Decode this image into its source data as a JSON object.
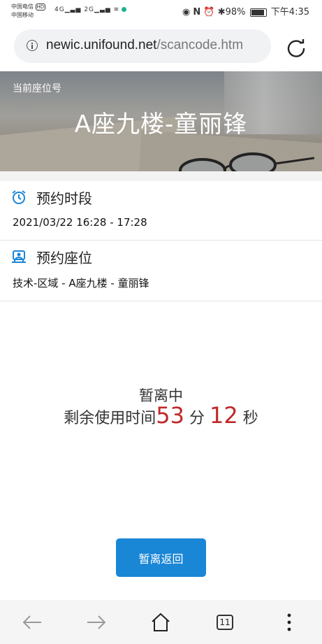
{
  "status_bar": {
    "carrier_1": "中国电信",
    "carrier_2": "中国移动",
    "badge": "HD",
    "signal_1": "4G",
    "signal_2": "2G",
    "battery": "98%",
    "time": "下午4:35"
  },
  "browser": {
    "url_host": "newic.unifound.net",
    "url_path": "/scancode.htm"
  },
  "banner": {
    "label": "当前座位号",
    "seat_title": "A座九楼-童丽锋"
  },
  "reservation": {
    "time_title": "预约时段",
    "time_value": "2021/03/22 16:28 - 17:28",
    "seat_title": "预约座位",
    "seat_value": "技术-区域 - A座九楼 - 童丽锋"
  },
  "away": {
    "status": "暂离中",
    "remain_prefix": "剩余使用时间",
    "minutes": "53",
    "min_unit": " 分 ",
    "seconds": "12",
    "sec_unit": " 秒"
  },
  "actions": {
    "return_label": "暂离返回"
  },
  "navbar": {
    "tab_count": "11"
  },
  "colors": {
    "accent": "#1a86d6",
    "countdown": "#c0282a"
  }
}
